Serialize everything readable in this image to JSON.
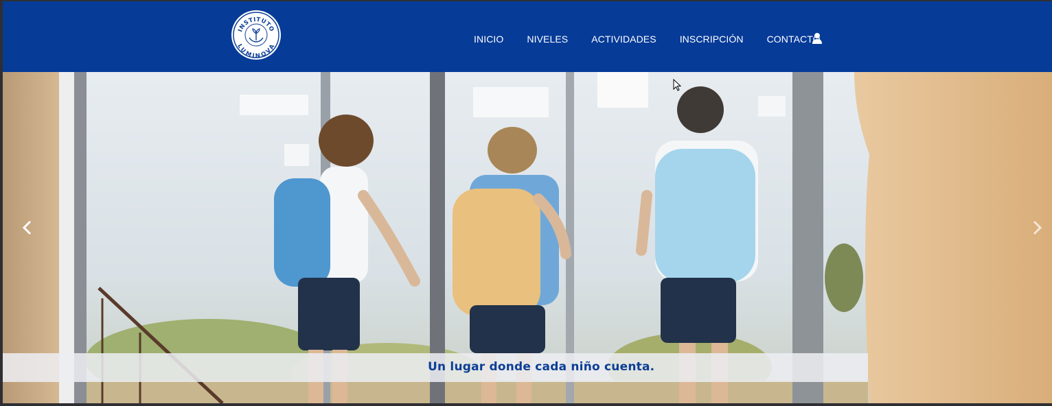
{
  "header": {
    "logo": {
      "top_text": "INSTITUTO",
      "bottom_text": "LUMINOVA",
      "icon": "hands-plant-icon"
    },
    "nav": [
      {
        "label": "INICIO"
      },
      {
        "label": "NIVELES"
      },
      {
        "label": "ACTIVIDADES"
      },
      {
        "label": "INSCRIPCIÓN"
      },
      {
        "label": "CONTACTO"
      }
    ],
    "account_icon": "user-icon"
  },
  "hero": {
    "caption": "Un lugar donde cada niño cuenta.",
    "prev_icon": "chevron-left-icon",
    "next_icon": "chevron-right-icon",
    "image_description_icon": "children-with-backpacks-photo"
  },
  "colors": {
    "header_bg": "#063b98",
    "caption_text": "#0c3e96",
    "caption_band": "#eceef2"
  }
}
